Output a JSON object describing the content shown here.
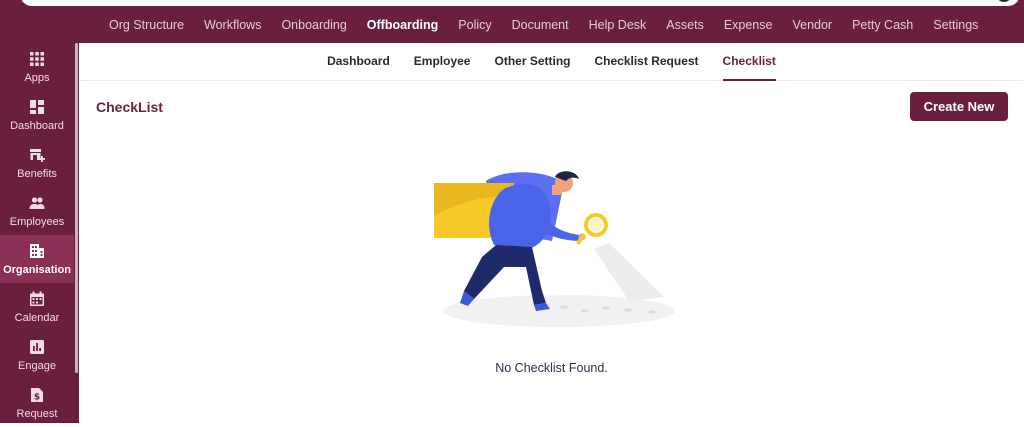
{
  "top_nav": {
    "items": [
      {
        "label": "Org Structure",
        "active": false
      },
      {
        "label": "Workflows",
        "active": false
      },
      {
        "label": "Onboarding",
        "active": false
      },
      {
        "label": "Offboarding",
        "active": true
      },
      {
        "label": "Policy",
        "active": false
      },
      {
        "label": "Document",
        "active": false
      },
      {
        "label": "Help Desk",
        "active": false
      },
      {
        "label": "Assets",
        "active": false
      },
      {
        "label": "Expense",
        "active": false
      },
      {
        "label": "Vendor",
        "active": false
      },
      {
        "label": "Petty Cash",
        "active": false
      },
      {
        "label": "Settings",
        "active": false
      }
    ]
  },
  "sidebar": {
    "items": [
      {
        "label": "Apps",
        "icon": "apps-grid-icon"
      },
      {
        "label": "Dashboard",
        "icon": "dashboard-icon"
      },
      {
        "label": "Benefits",
        "icon": "benefits-icon"
      },
      {
        "label": "Employees",
        "icon": "people-icon"
      },
      {
        "label": "Organisation",
        "icon": "building-icon",
        "active": true
      },
      {
        "label": "Calendar",
        "icon": "calendar-icon"
      },
      {
        "label": "Engage",
        "icon": "chart-icon"
      },
      {
        "label": "Request",
        "icon": "request-icon"
      }
    ]
  },
  "sub_nav": {
    "items": [
      {
        "label": "Dashboard",
        "active": false
      },
      {
        "label": "Employee",
        "active": false
      },
      {
        "label": "Other Setting",
        "active": false
      },
      {
        "label": "Checklist Request",
        "active": false
      },
      {
        "label": "Checklist",
        "active": true
      }
    ]
  },
  "main": {
    "title": "CheckList",
    "create_button_label": "Create New",
    "empty_message": "No Checklist Found."
  },
  "colors": {
    "brand": "#6b1f3f",
    "active_sidebar": "#8a2f55"
  }
}
